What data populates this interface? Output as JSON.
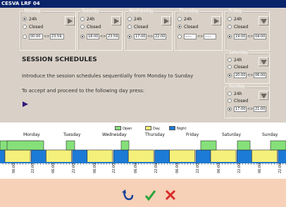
{
  "window": {
    "title": "CESVA LRF 04"
  },
  "days": [
    {
      "key": "monday",
      "label": "Monday",
      "opt24": "24h",
      "optClosed": "Closed",
      "from": "00:00",
      "to": "23:59",
      "selected": "24h"
    },
    {
      "key": "tuesday",
      "label": "Tuesday",
      "opt24": "24h",
      "optClosed": "Closed",
      "from": "18:00",
      "to": "23:59",
      "selected": "range"
    },
    {
      "key": "wednesday",
      "label": "Wednesday",
      "opt24": "24h",
      "optClosed": "Closed",
      "from": "17:00",
      "to": "22:00",
      "selected": "range"
    },
    {
      "key": "thursday",
      "label": "Thursday",
      "opt24": "24h",
      "optClosed": "Closed",
      "from": "--:--",
      "to": "--:--",
      "selected": "closed"
    },
    {
      "key": "friday",
      "label": "Friday",
      "opt24": "24h",
      "optClosed": "Closed",
      "from": "19:00",
      "to": "04:00",
      "selected": "range"
    },
    {
      "key": "saturday",
      "label": "Saturday",
      "opt24": "24h",
      "optClosed": "Closed",
      "from": "20:00",
      "to": "06:00",
      "selected": "range"
    },
    {
      "key": "sunday",
      "label": "Sunday",
      "opt24": "24h",
      "optClosed": "Closed",
      "from": "17:00",
      "to": "21:00",
      "selected": "range"
    }
  ],
  "panel": {
    "heading": "SESSION SCHEDULES",
    "line1": "Introduce the session schedules sequentially from Monday to Sunday",
    "line2": "To accept and proceed to the following day press:"
  },
  "legend": {
    "open": {
      "label": "Open",
      "color": "#86e07a"
    },
    "day": {
      "label": "Day",
      "color": "#f4f07a"
    },
    "night": {
      "label": "Night",
      "color": "#1c7bd6"
    }
  },
  "timeline": {
    "days": [
      "Monday",
      "Tuesday",
      "Wednesday",
      "Thursday",
      "Friday",
      "Saturday",
      "Sunday"
    ],
    "ticks": [
      "06:00",
      "22:00"
    ]
  },
  "actions": {
    "back": "back-icon",
    "accept": "check-icon",
    "cancel": "cross-icon",
    "accept_color": "#2aa43a",
    "cancel_color": "#d92a2a"
  }
}
